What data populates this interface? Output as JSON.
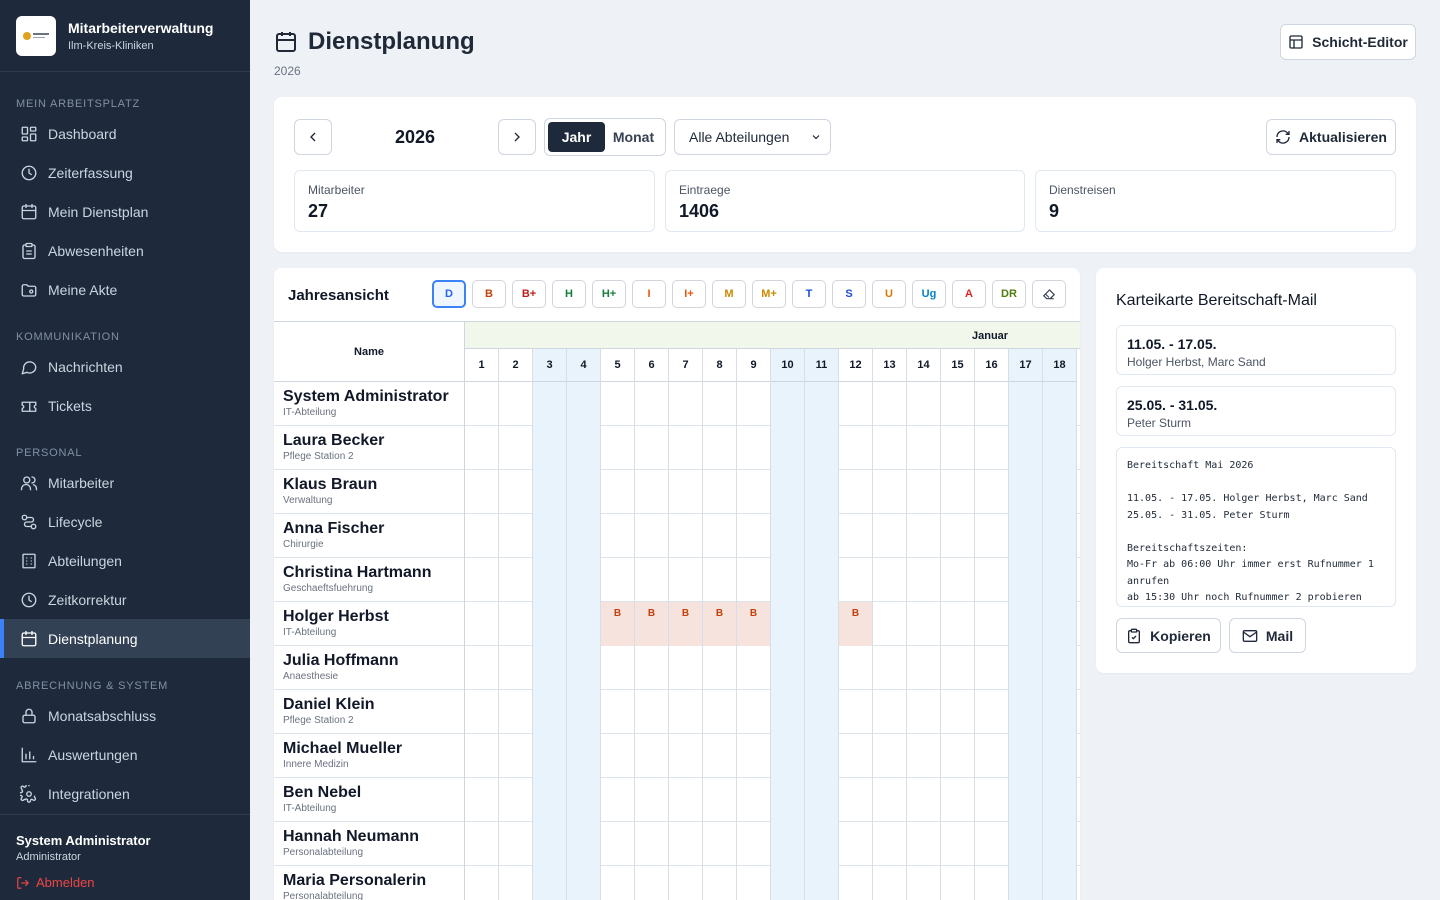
{
  "app": {
    "title": "Mitarbeiterverwaltung",
    "subtitle": "Ilm-Kreis-Kliniken"
  },
  "sidebar": {
    "sections": [
      {
        "label": "MEIN ARBEITSPLATZ",
        "items": [
          {
            "label": "Dashboard",
            "icon": "dashboard-icon"
          },
          {
            "label": "Zeiterfassung",
            "icon": "clock-icon"
          },
          {
            "label": "Mein Dienstplan",
            "icon": "calendar-icon"
          },
          {
            "label": "Abwesenheiten",
            "icon": "clipboard-icon"
          },
          {
            "label": "Meine Akte",
            "icon": "folder-icon"
          }
        ]
      },
      {
        "label": "KOMMUNIKATION",
        "items": [
          {
            "label": "Nachrichten",
            "icon": "message-icon"
          },
          {
            "label": "Tickets",
            "icon": "ticket-icon"
          }
        ]
      },
      {
        "label": "PERSONAL",
        "items": [
          {
            "label": "Mitarbeiter",
            "icon": "users-icon"
          },
          {
            "label": "Lifecycle",
            "icon": "route-icon"
          },
          {
            "label": "Abteilungen",
            "icon": "building-icon"
          },
          {
            "label": "Zeitkorrektur",
            "icon": "clock-icon"
          },
          {
            "label": "Dienstplanung",
            "icon": "calendar-icon",
            "active": true
          }
        ]
      },
      {
        "label": "ABRECHNUNG & SYSTEM",
        "items": [
          {
            "label": "Monatsabschluss",
            "icon": "lock-icon"
          },
          {
            "label": "Auswertungen",
            "icon": "chart-icon"
          },
          {
            "label": "Integrationen",
            "icon": "gear-icon"
          }
        ]
      }
    ],
    "user": {
      "name": "System Administrator",
      "role": "Administrator",
      "logout": "Abmelden"
    }
  },
  "page": {
    "title": "Dienstplanung",
    "subtitle": "2026",
    "shift_editor": "Schicht-Editor"
  },
  "controls": {
    "year": "2026",
    "view_year": "Jahr",
    "view_month": "Monat",
    "department": "Alle Abteilungen",
    "refresh": "Aktualisieren",
    "stats": [
      {
        "label": "Mitarbeiter",
        "value": "27"
      },
      {
        "label": "Eintraege",
        "value": "1406"
      },
      {
        "label": "Dienstreisen",
        "value": "9"
      }
    ]
  },
  "year_view": {
    "title": "Jahresansicht",
    "codes": [
      {
        "code": "D",
        "color": "#2563eb",
        "selected": true
      },
      {
        "code": "B",
        "color": "#c2410c"
      },
      {
        "code": "B+",
        "color": "#b91c1c"
      },
      {
        "code": "H",
        "color": "#15803d"
      },
      {
        "code": "H+",
        "color": "#15803d"
      },
      {
        "code": "I",
        "color": "#ea580c"
      },
      {
        "code": "I+",
        "color": "#ea580c"
      },
      {
        "code": "M",
        "color": "#ca8a04"
      },
      {
        "code": "M+",
        "color": "#ca8a04"
      },
      {
        "code": "T",
        "color": "#1d4ed8"
      },
      {
        "code": "S",
        "color": "#1d4ed8"
      },
      {
        "code": "U",
        "color": "#d97706"
      },
      {
        "code": "Ug",
        "color": "#0284c7"
      },
      {
        "code": "A",
        "color": "#dc2626"
      },
      {
        "code": "DR",
        "color": "#4d7c0f"
      }
    ],
    "name_header": "Name",
    "month": "Januar",
    "days": [
      "1",
      "2",
      "3",
      "4",
      "5",
      "6",
      "7",
      "8",
      "9",
      "10",
      "11",
      "12",
      "13",
      "14",
      "15",
      "16",
      "17",
      "18"
    ],
    "weekend_days": [
      3,
      4,
      10,
      11,
      17,
      18
    ],
    "rows": [
      {
        "name": "System Administrator",
        "dept": "IT-Abteilung",
        "entries": {}
      },
      {
        "name": "Laura Becker",
        "dept": "Pflege Station 2",
        "entries": {}
      },
      {
        "name": "Klaus Braun",
        "dept": "Verwaltung",
        "entries": {}
      },
      {
        "name": "Anna Fischer",
        "dept": "Chirurgie",
        "entries": {}
      },
      {
        "name": "Christina Hartmann",
        "dept": "Geschaeftsfuehrung",
        "entries": {}
      },
      {
        "name": "Holger Herbst",
        "dept": "IT-Abteilung",
        "entries": {
          "5": "B",
          "6": "B",
          "7": "B",
          "8": "B",
          "9": "B",
          "12": "B"
        }
      },
      {
        "name": "Julia Hoffmann",
        "dept": "Anaesthesie",
        "entries": {}
      },
      {
        "name": "Daniel Klein",
        "dept": "Pflege Station 2",
        "entries": {}
      },
      {
        "name": "Michael Mueller",
        "dept": "Innere Medizin",
        "entries": {}
      },
      {
        "name": "Ben Nebel",
        "dept": "IT-Abteilung",
        "entries": {}
      },
      {
        "name": "Hannah Neumann",
        "dept": "Personalabteilung",
        "entries": {}
      },
      {
        "name": "Maria Personalerin",
        "dept": "Personalabteilung",
        "entries": {}
      }
    ]
  },
  "mail_card": {
    "title": "Karteikarte Bereitschaft-Mail",
    "entries": [
      {
        "range": "11.05. - 17.05.",
        "people": "Holger Herbst, Marc Sand"
      },
      {
        "range": "25.05. - 31.05.",
        "people": "Peter Sturm"
      }
    ],
    "text_lines": [
      "Bereitschaft Mai 2026",
      "",
      "11.05. - 17.05. Holger Herbst, Marc Sand",
      "25.05. - 31.05. Peter Sturm",
      "",
      "Bereitschaftszeiten:",
      "Mo-Fr ab 06:00 Uhr immer erst Rufnummer 1",
      "anrufen",
      "ab 15:30 Uhr noch Rufnummer 2 probieren"
    ],
    "copy": "Kopieren",
    "mail": "Mail"
  }
}
